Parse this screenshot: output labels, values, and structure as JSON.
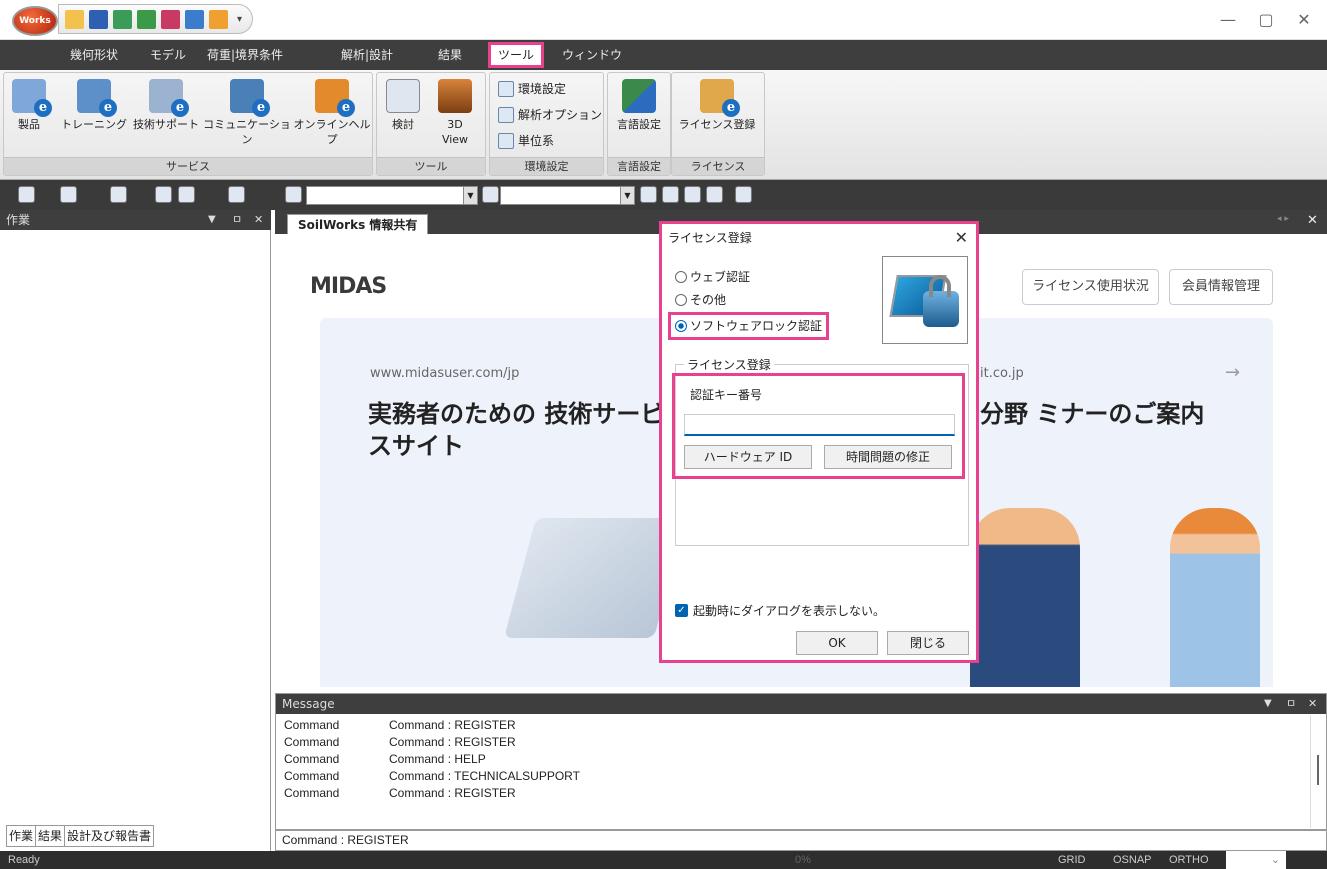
{
  "app": {
    "logo_text": "Works",
    "menu": [
      "幾何形状",
      "モデル",
      "荷重|境界条件",
      "解析|設計",
      "結果",
      "ツール",
      "ウィンドウ"
    ]
  },
  "ribbon": {
    "service_group": "サービス",
    "service_buttons": [
      "製品",
      "トレーニング",
      "技術サポート",
      "コミュニケーション",
      "オンラインヘルプ"
    ],
    "tool_group": "ツール",
    "tool_buttons": [
      "検討",
      "3D View"
    ],
    "env_group": "環境設定",
    "env_buttons": [
      "環境設定",
      "解析オプション",
      "単位系"
    ],
    "lang_group": "言語設定",
    "lang_button": "言語設定",
    "license_group": "ライセンス",
    "license_button": "ライセンス登録"
  },
  "left_panel": {
    "title": "作業",
    "tabs": [
      "作業",
      "結果",
      "設計及び報告書"
    ]
  },
  "main": {
    "tab": "SoilWorks 情報共有",
    "logo": "MIDAS",
    "btn_license_usage": "ライセンス使用状況",
    "btn_member": "会員情報管理",
    "banner_url": "www.midasuser.com/jp",
    "banner_title": "実務者のための 技術サービスサイト",
    "banner_url2": "it.co.jp",
    "banner_title2": "分野 ミナーのご案内",
    "arrow": "→"
  },
  "message": {
    "title": "Message",
    "rows": [
      {
        "type": "Command",
        "text": "Command : REGISTER"
      },
      {
        "type": "Command",
        "text": "Command : REGISTER"
      },
      {
        "type": "Command",
        "text": "Command : HELP"
      },
      {
        "type": "Command",
        "text": "Command : TECHNICALSUPPORT"
      },
      {
        "type": "Command",
        "text": "Command : REGISTER"
      }
    ],
    "command_line": "Command :  REGISTER"
  },
  "status": {
    "ready": "Ready",
    "percent": "0%",
    "grid": "GRID",
    "osnap": "OSNAP",
    "ortho": "ORTHO"
  },
  "dialog": {
    "title": "ライセンス登録",
    "radio_web": "ウェブ認証",
    "radio_other": "その他",
    "radio_lock": "ソフトウェアロック認証",
    "fieldset_label": "ライセンス登録",
    "key_label": "認証キー番号",
    "key_value": "",
    "btn_hardware": "ハードウェア ID",
    "btn_time": "時間問題の修正",
    "checkbox_label": "起動時にダイアログを表示しない。",
    "btn_ok": "OK",
    "btn_close": "閉じる"
  }
}
